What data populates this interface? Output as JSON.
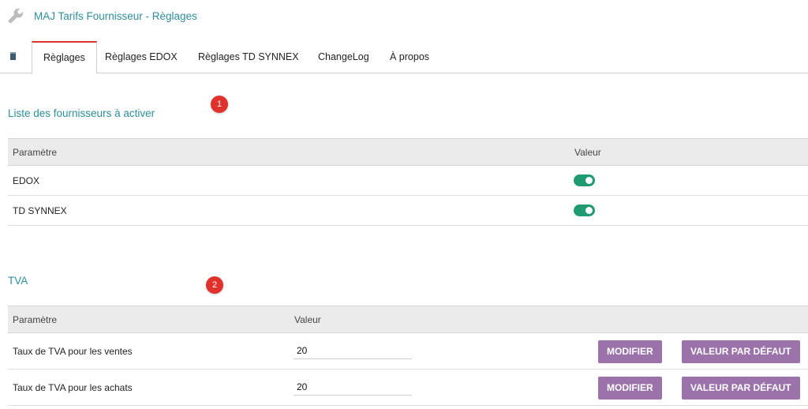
{
  "header": {
    "title": "MAJ Tarifs Fournisseur - Règlages"
  },
  "tabs": [
    {
      "label": "Règlages",
      "active": true
    },
    {
      "label": "Règlages EDOX",
      "active": false
    },
    {
      "label": "Règlages TD SYNNEX",
      "active": false
    },
    {
      "label": "ChangeLog",
      "active": false
    },
    {
      "label": "À propos",
      "active": false
    }
  ],
  "suppliers": {
    "badge": "1",
    "title": "Liste des fournisseurs à activer",
    "columns": [
      "Paramètre",
      "Valeur"
    ],
    "rows": [
      {
        "label": "EDOX",
        "enabled": true
      },
      {
        "label": "TD SYNNEX",
        "enabled": true
      }
    ]
  },
  "vat": {
    "badge": "2",
    "title": "TVA",
    "columns": [
      "Paramètre",
      "Valeur"
    ],
    "rows": [
      {
        "label": "Taux de TVA pour les ventes",
        "value": "20",
        "modify_label": "MODIFIER",
        "default_label": "VALEUR PAR DÉFAUT"
      },
      {
        "label": "Taux de TVA pour les achats",
        "value": "20",
        "modify_label": "MODIFIER",
        "default_label": "VALEUR PAR DÉFAUT"
      }
    ]
  },
  "colors": {
    "accent_teal": "#2d8e9b",
    "badge_red": "#e0322c",
    "toggle_green": "#1f9a71",
    "button_purple": "#9b72aa"
  },
  "icons": {
    "title": "wrench-icon",
    "tab_bar": "module-icon"
  }
}
